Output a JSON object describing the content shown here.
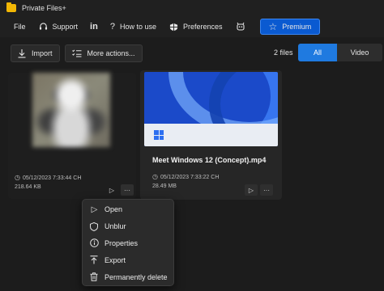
{
  "window": {
    "title": "Private Files+"
  },
  "menu": {
    "file": "File",
    "support": "Support",
    "linkedin": "in",
    "how_to_use": "How to use",
    "preferences": "Preferences",
    "premium": "Premium"
  },
  "toolbar": {
    "import": "Import",
    "more_actions": "More actions...",
    "files_count": "2 files",
    "filter_all": "All",
    "filter_video": "Video"
  },
  "cards": [
    {
      "title": "",
      "date": "05/12/2023 7:33:44 CH",
      "size": "218.64 KB"
    },
    {
      "title": "Meet Windows 12 (Concept).mp4",
      "date": "05/12/2023 7:33:22 CH",
      "size": "28.49 MB"
    }
  ],
  "context_menu": {
    "open": "Open",
    "unblur": "Unblur",
    "properties": "Properties",
    "export": "Export",
    "delete": "Permanently delete"
  },
  "colors": {
    "accent": "#1f7ae0",
    "premium": "#0a5ad1",
    "background": "#1c1c1c"
  }
}
